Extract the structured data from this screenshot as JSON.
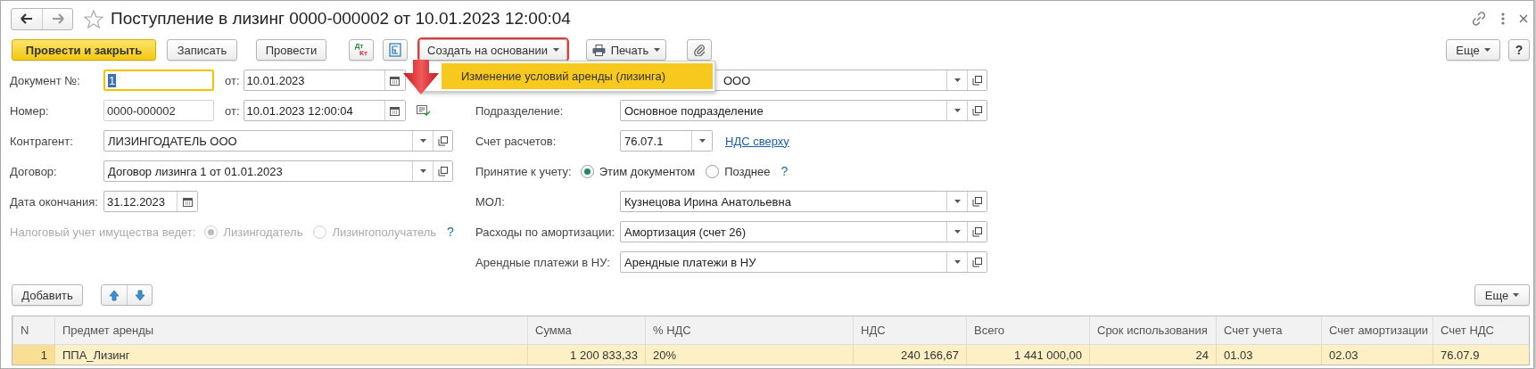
{
  "window": {
    "title": "Поступление в лизинг 0000-000002 от 10.01.2023 12:00:04",
    "favorite": false
  },
  "toolbar": {
    "buttons": [
      {
        "kind": "primary",
        "label": "Провести и закрыть"
      },
      {
        "kind": "plain",
        "label": "Записать"
      },
      {
        "kind": "plain",
        "label": "Провести"
      },
      {
        "kind": "dtkt",
        "top": "Дт",
        "bottom": "Кт"
      },
      {
        "kind": "structure"
      },
      {
        "kind": "dropdown",
        "label": "Создать на основании",
        "annotated": true
      },
      {
        "kind": "print",
        "label": "Печать"
      },
      {
        "kind": "attach"
      },
      {
        "kind": "more",
        "label": "Еще"
      },
      {
        "kind": "help",
        "label": "?"
      }
    ]
  },
  "create_menu": {
    "items": [
      {
        "label": "Изменение условий аренды (лизинга)",
        "selected": true
      }
    ]
  },
  "form": {
    "left": [
      {
        "kind": "number-date",
        "label": "Документ №:",
        "value": "1",
        "focused": true,
        "date_label": "от:",
        "date": "10.01.2023"
      },
      {
        "kind": "number-date-status",
        "label": "Номер:",
        "value": "0000-000002",
        "focused": false,
        "date_label": "от:",
        "date": "10.01.2023 12:00:04"
      },
      {
        "kind": "combo",
        "label": "Контрагент:",
        "value": "ЛИЗИНГОДАТЕЛЬ ООО"
      },
      {
        "kind": "combo",
        "label": "Договор:",
        "value": "Договор лизинга 1 от 01.01.2023"
      },
      {
        "kind": "date",
        "label": "Дата окончания:",
        "value": "31.12.2023"
      },
      {
        "kind": "radio",
        "label": "Налоговый учет имущества ведет:",
        "disabled": true,
        "options": [
          {
            "label": "Лизингодатель",
            "selected": true
          },
          {
            "label": "Лизингополучатель",
            "selected": false
          }
        ],
        "help": "?"
      }
    ],
    "right": [
      {
        "kind": "combo",
        "value": "ООО"
      },
      {
        "kind": "combo",
        "label": "Подразделение:",
        "value": "Основное подразделение"
      },
      {
        "kind": "combo-link",
        "label": "Счет расчетов:",
        "value": "76.07.1",
        "link": "НДС сверху"
      },
      {
        "kind": "radio",
        "label": "Принятие к учету:",
        "disabled": false,
        "options": [
          {
            "label": "Этим документом",
            "selected": true
          },
          {
            "label": "Позднее",
            "selected": false
          }
        ],
        "help": "?"
      },
      {
        "kind": "combo",
        "label": "МОЛ:",
        "value": "Кузнецова Ирина Анатольевна"
      },
      {
        "kind": "combo",
        "label": "Расходы по амортизации:",
        "value": "Амортизация (счет 26)"
      },
      {
        "kind": "combo",
        "label": "Арендные платежи в НУ:",
        "value": "Арендные платежи в НУ"
      }
    ]
  },
  "table": {
    "buttons": [
      {
        "kind": "add",
        "label": "Добавить"
      },
      {
        "kind": "up"
      },
      {
        "kind": "down"
      },
      {
        "kind": "more",
        "label": "Еще"
      }
    ],
    "columns": [
      {
        "label": "N",
        "kind": "number"
      },
      {
        "label": "Предмет аренды",
        "kind": "text"
      },
      {
        "label": "Сумма",
        "kind": "number"
      },
      {
        "label": "% НДС",
        "kind": "text"
      },
      {
        "label": "НДС",
        "kind": "number"
      },
      {
        "label": "Всего",
        "kind": "number"
      },
      {
        "label": "Срок использования",
        "kind": "number"
      },
      {
        "label": "Счет учета",
        "kind": "text"
      },
      {
        "label": "Счет амортизации",
        "kind": "text"
      },
      {
        "label": "Счет НДС",
        "kind": "text"
      }
    ],
    "rows": [
      {
        "selected": true,
        "cells": [
          "1",
          "ППА_Лизинг",
          "1 200 833,33",
          "20%",
          "240 166,67",
          "1 441 000,00",
          "24",
          "01.03",
          "02.03",
          "76.07.9"
        ]
      }
    ]
  }
}
